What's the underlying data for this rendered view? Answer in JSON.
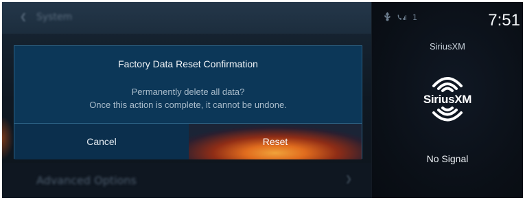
{
  "background": {
    "title": "System",
    "row_label": "Advanced Options"
  },
  "dialog": {
    "title": "Factory Data Reset Confirmation",
    "message_line1": "Permanently delete all data?",
    "message_line2": "Once this action is complete, it cannot be undone.",
    "cancel_label": "Cancel",
    "reset_label": "Reset"
  },
  "status_bar": {
    "time": "7:51",
    "indicator": "1",
    "icons": [
      "usb-icon",
      "phone-signal-icon"
    ]
  },
  "now_playing": {
    "source": "SiriusXM",
    "logo_text": "SiriusXM",
    "status": "No Signal"
  },
  "colors": {
    "dialog_bg": "#0c3758",
    "reset_accent": "#e06c1e",
    "screen_bg": "#0a0f15"
  }
}
